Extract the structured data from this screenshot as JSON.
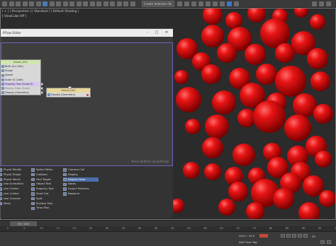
{
  "toolbar": {
    "selection_set": "Create Selection Se",
    "icons": [
      "undo-icon",
      "redo-icon",
      "link-icon",
      "unlink-icon",
      "bind-icon",
      "all-icon",
      "select-icon",
      "region-icon",
      "window-icon",
      "move-icon",
      "rotate-icon",
      "scale-icon",
      "place-icon",
      "view-icon",
      "pivot-icon",
      "snap-icon",
      "angle-snap-icon",
      "percent-snap-icon",
      "spinner-snap-icon",
      "edit-named-icon"
    ]
  },
  "viewport": {
    "label": "[ + ] [ Perspective ] [ Standard ] [ Default Shading ]",
    "label2": "[ ViewCube Off ]",
    "sphere_color": "#e01515"
  },
  "particle_view": {
    "title": "PFlow Editor",
    "watermark": "Press Shift for QuantPicker",
    "event1": {
      "title": "Event_001",
      "operators": [
        {
          "label": "Birth (0-0 200)",
          "icon": "birth-icon"
        },
        {
          "label": "Shape",
          "icon": "shape-icon"
        },
        {
          "label": "Speed",
          "icon": "speed-icon"
        },
        {
          "label": "Scale 01 (Add)",
          "icon": "scale-icon"
        },
        {
          "label": "Property Test (Scale 0)",
          "icon": "test-icon",
          "highlight": true
        },
        {
          "label": "Display Data (Scale)",
          "icon": "display-icon",
          "dim": true
        },
        {
          "label": "Display (Geometry)",
          "icon": "display-icon"
        }
      ]
    },
    "event2": {
      "title": "Event_002",
      "operators": [
        {
          "label": "Display (Geometry)",
          "icon": "display-icon"
        }
      ]
    }
  },
  "depot": {
    "col1": [
      "PhysX Modify",
      "PhysX Shape",
      "PhysX World",
      "ctor Animation",
      "ctor Center",
      "ctor Collect",
      "ctor Convert",
      "Mesh"
    ],
    "col2": [
      "Spline Paths",
      "Collision",
      "Find Target",
      "Object Test",
      "Property Test",
      "Send Out",
      "Split",
      "Surface Test",
      "Time Test"
    ],
    "col3": [
      "Camera Cull",
      "Display",
      "Display Data",
      "Notes",
      "Export Particles",
      "Baseline"
    ],
    "selected": "Display Data"
  },
  "timeline": {
    "slider": "35 / 100",
    "ticks": [
      "0",
      "5",
      "10",
      "15",
      "20",
      "25",
      "30",
      "35",
      "40",
      "45",
      "50",
      "55",
      "60",
      "65",
      "70",
      "75",
      "80",
      "85",
      "90",
      "95",
      "100"
    ]
  },
  "status": {
    "grid": "Grid = 10.0",
    "add_time_tag": "Add Time Tag",
    "frame": "35",
    "undo_label": "Undo"
  }
}
